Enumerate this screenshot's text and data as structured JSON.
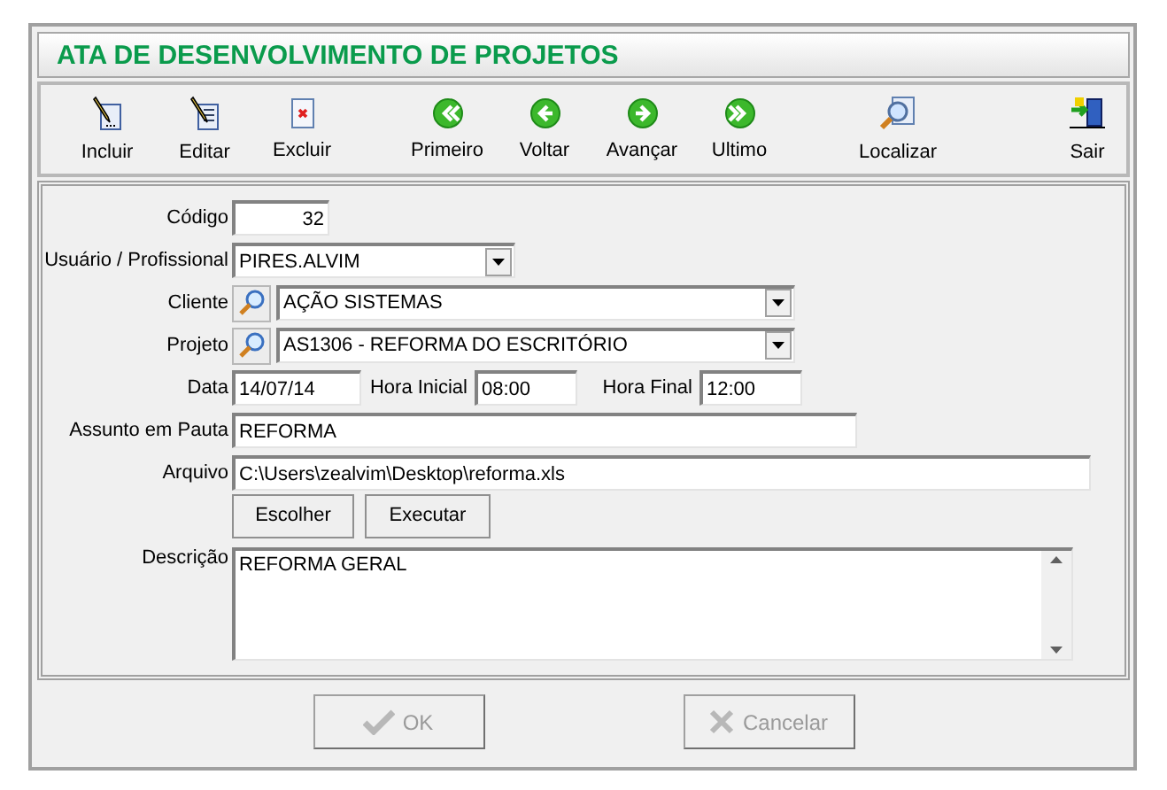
{
  "window": {
    "title": "ATA DE DESENVOLVIMENTO DE PROJETOS"
  },
  "toolbar": [
    {
      "buttons": [
        {
          "label": "Incluir",
          "kind": "new"
        },
        {
          "label": "Editar",
          "kind": "edit"
        },
        {
          "label": "Excluir",
          "kind": "delete"
        }
      ]
    },
    {
      "buttons": [
        {
          "label": "Primeiro",
          "kind": "first"
        },
        {
          "label": "Voltar",
          "kind": "prev"
        },
        {
          "label": "Avançar",
          "kind": "next"
        },
        {
          "label": "Ultimo",
          "kind": "last"
        }
      ]
    },
    {
      "buttons": [
        {
          "label": "Localizar",
          "kind": "find"
        }
      ]
    },
    {
      "buttons": [
        {
          "label": "Sair",
          "kind": "exit"
        }
      ]
    }
  ],
  "form": {
    "rows": [
      {
        "label": "Código",
        "fields": [
          {
            "kind": "number",
            "value": "32"
          }
        ]
      },
      {
        "label": "Usuário / Profissional",
        "fields": [
          {
            "kind": "combo",
            "value": "PIRES.ALVIM"
          }
        ]
      },
      {
        "label": "Cliente",
        "fields": [
          {
            "kind": "lookup",
            "value": "AÇÃO SISTEMAS"
          }
        ]
      },
      {
        "label": "Projeto",
        "fields": [
          {
            "kind": "lookup",
            "value": "AS1306 - REFORMA DO ESCRITÓRIO"
          }
        ]
      },
      {
        "label": "Data",
        "fields": [
          {
            "kind": "text",
            "value": "14/07/14"
          },
          {
            "kind": "label",
            "text": "Hora Inicial"
          },
          {
            "kind": "text",
            "value": "08:00"
          },
          {
            "kind": "label",
            "text": "Hora Final"
          },
          {
            "kind": "text",
            "value": "12:00"
          }
        ]
      },
      {
        "label": "Assunto em Pauta",
        "fields": [
          {
            "kind": "text",
            "value": "REFORMA"
          }
        ]
      },
      {
        "label": "Arquivo",
        "fields": [
          {
            "kind": "text",
            "value": "C:\\Users\\zealvim\\Desktop\\reforma.xls"
          }
        ]
      },
      {
        "fields": [
          {
            "kind": "button",
            "text": "Escolher"
          },
          {
            "kind": "button",
            "text": "Executar"
          }
        ]
      },
      {
        "label": "Descrição",
        "fields": [
          {
            "kind": "memo",
            "value": "REFORMA GERAL"
          }
        ]
      }
    ]
  },
  "footer": [
    {
      "label": "OK",
      "kind": "ok",
      "disabled": true
    },
    {
      "label": "Cancelar",
      "kind": "cancel",
      "disabled": true
    }
  ]
}
